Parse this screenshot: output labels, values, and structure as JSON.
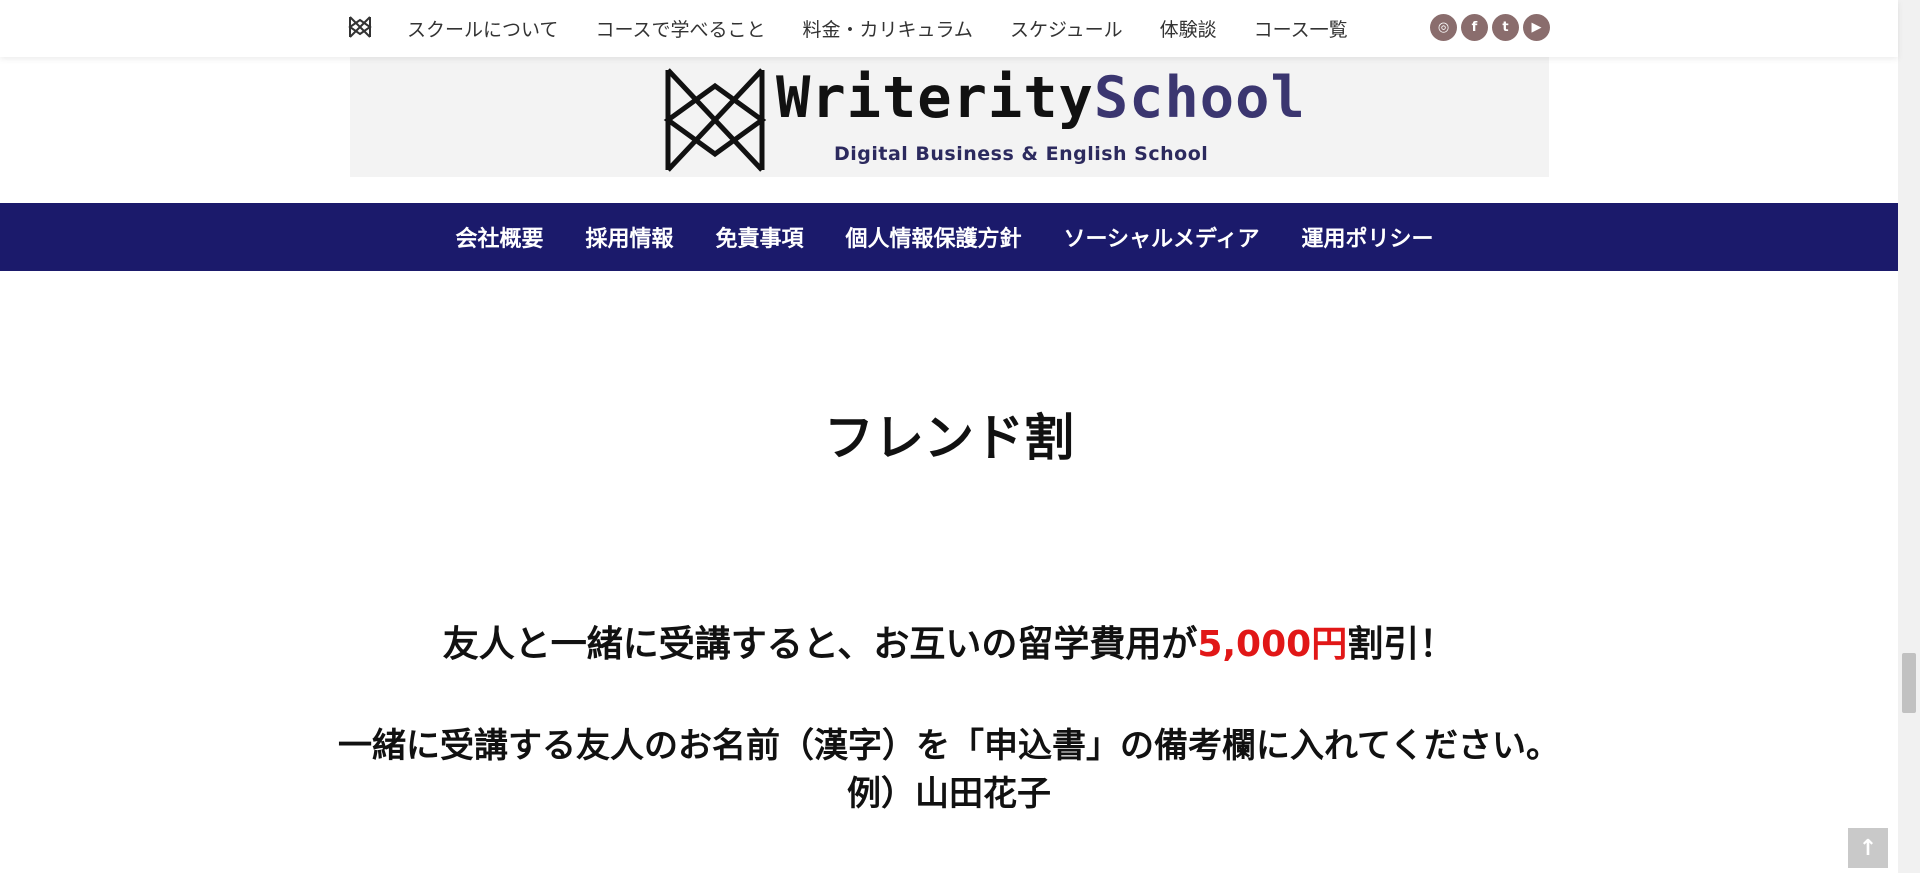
{
  "topnav": {
    "items": [
      {
        "label": "スクールについて"
      },
      {
        "label": "コースで学べること"
      },
      {
        "label": "料金・カリキュラム"
      },
      {
        "label": "スケジュール"
      },
      {
        "label": "体験談"
      },
      {
        "label": "コース一覧"
      }
    ],
    "social": [
      {
        "icon": "instagram-icon",
        "glyph": "◎"
      },
      {
        "icon": "facebook-icon",
        "glyph": "f"
      },
      {
        "icon": "twitter-icon",
        "glyph": "t"
      },
      {
        "icon": "youtube-icon",
        "glyph": "▶"
      }
    ]
  },
  "banner": {
    "brand_part1": "Writerity",
    "brand_part2": "School",
    "tagline": "Digital Business & English School"
  },
  "menubar": {
    "items": [
      {
        "label": "会社概要"
      },
      {
        "label": "採用情報"
      },
      {
        "label": "免責事項"
      },
      {
        "label": "個人情報保護方針"
      },
      {
        "label": "ソーシャルメディア"
      },
      {
        "label": "運用ポリシー"
      }
    ]
  },
  "content": {
    "title": "フレンド割",
    "lead_before": "友人と一緒に受講すると、お互いの留学費用が",
    "lead_price": "5,000円",
    "lead_after": "割引！",
    "note_line1": "一緒に受講する友人のお名前（漢字）を「申込書」の備考欄に入れてください。",
    "note_line2": "例）山田花子"
  },
  "colors": {
    "menubar_bg": "#1b1a6b",
    "price": "#e11717",
    "social_bg": "#8a6d6d"
  },
  "back_to_top": "↑"
}
